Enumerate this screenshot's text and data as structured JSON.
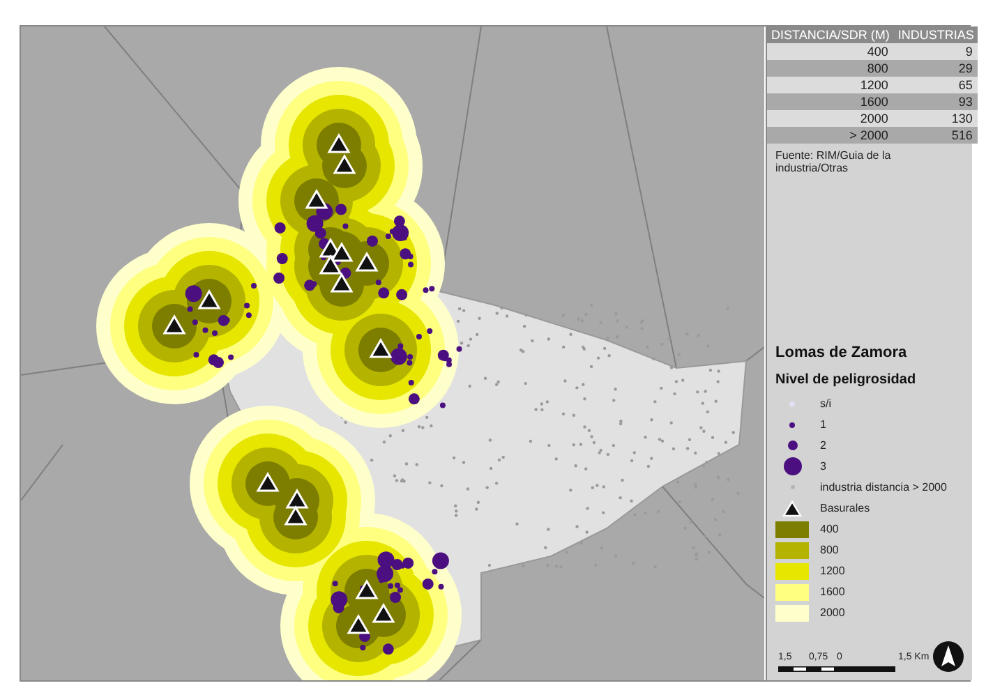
{
  "table": {
    "columns": [
      "DISTANCIA/SDR (M)",
      "INDUSTRIAS"
    ],
    "rows": [
      [
        "400",
        "9"
      ],
      [
        "800",
        "29"
      ],
      [
        "1200",
        "65"
      ],
      [
        "1600",
        "93"
      ],
      [
        "2000",
        "130"
      ],
      [
        "> 2000",
        "516"
      ]
    ]
  },
  "source": "Fuente: RIM/Guia de la industria/Otras",
  "legend": {
    "title": "Lomas de Zamora",
    "subtitle": "Nivel de peligrosidad",
    "items": [
      {
        "kind": "faint",
        "label": "s/i"
      },
      {
        "kind": "small",
        "label": "1"
      },
      {
        "kind": "medium",
        "label": "2"
      },
      {
        "kind": "large",
        "label": "3"
      },
      {
        "kind": "grey",
        "label": "industria distancia > 2000"
      },
      {
        "kind": "triangle",
        "label": "Basurales"
      },
      {
        "kind": "swatch",
        "label": "400",
        "color": "#7d7d00"
      },
      {
        "kind": "swatch",
        "label": "800",
        "color": "#b3b300"
      },
      {
        "kind": "swatch",
        "label": "1200",
        "color": "#e6e600"
      },
      {
        "kind": "swatch",
        "label": "1600",
        "color": "#ffff80"
      },
      {
        "kind": "swatch",
        "label": "2000",
        "color": "#ffffcc"
      }
    ]
  },
  "scale_bar": {
    "labels": [
      "1,5",
      "0,75",
      "0",
      "1,5 Km"
    ]
  }
}
